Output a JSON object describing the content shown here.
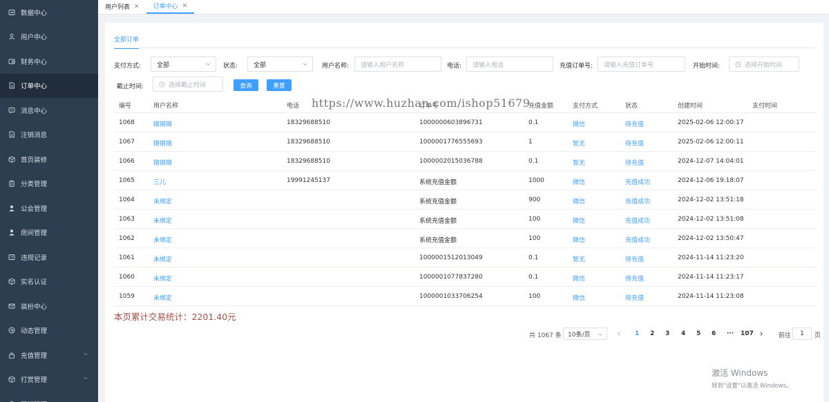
{
  "sidebar": {
    "items": [
      {
        "label": "数据中心",
        "icon": "dashboard-icon"
      },
      {
        "label": "用户中心",
        "icon": "user-icon"
      },
      {
        "label": "财务中心",
        "icon": "wallet-icon"
      },
      {
        "label": "订单中心",
        "icon": "document-icon",
        "active": true
      },
      {
        "label": "消息中心",
        "icon": "message-icon"
      },
      {
        "label": "注销消息",
        "icon": "document-icon"
      },
      {
        "label": "首页装修",
        "icon": "box-icon"
      },
      {
        "label": "分类管理",
        "icon": "clipboard-icon"
      },
      {
        "label": "公会管理",
        "icon": "person-icon"
      },
      {
        "label": "房间管理",
        "icon": "person-icon"
      },
      {
        "label": "违规记录",
        "icon": "list-icon"
      },
      {
        "label": "实名认证",
        "icon": "box-icon"
      },
      {
        "label": "装扮中心",
        "icon": "mail-icon"
      },
      {
        "label": "动态管理",
        "icon": "activity-icon"
      },
      {
        "label": "充值管理",
        "icon": "lock-icon",
        "caret": true
      },
      {
        "label": "打赏管理",
        "icon": "box-icon",
        "caret": true
      },
      {
        "label": "营销管理",
        "icon": "box-icon",
        "caret": true
      }
    ]
  },
  "tabs": [
    {
      "label": "用户列表",
      "close": "✕"
    },
    {
      "label": "订单中心",
      "close": "✕",
      "active": true
    }
  ],
  "subtab": {
    "label": "全部订单"
  },
  "filters": {
    "pay_method_label": "支付方式:",
    "pay_method_value": "全部",
    "status_label": "状态:",
    "status_value": "全部",
    "username_label": "用户名称:",
    "username_placeholder": "请输入用户名称",
    "phone_label": "电话:",
    "phone_placeholder": "请输入电话",
    "order_no_label": "充值订单号:",
    "order_no_placeholder": "请输入充值订单号",
    "start_label": "开始时间:",
    "start_placeholder": "选择开始时间",
    "end_label": "截止时间:",
    "end_placeholder": "选择截止时间",
    "query_button": "查询",
    "reset_button": "重置"
  },
  "table": {
    "headers": [
      "编号",
      "用户名称",
      "电话",
      "订单号",
      "充值金额",
      "支付方式",
      "状态",
      "创建时间",
      "支付时间"
    ],
    "rows": [
      {
        "id": "1068",
        "user": "锵锵锵",
        "phone": "18329688510",
        "order": "1000000603896731",
        "amount": "0.1",
        "method": "微信",
        "status": "待充值",
        "created": "2025-02-06 12:00:17",
        "paid": ""
      },
      {
        "id": "1067",
        "user": "锵锵锵",
        "phone": "18329688510",
        "order": "1000001776555693",
        "amount": "1",
        "method": "暂无",
        "status": "待充值",
        "created": "2025-02-06 12:00:11",
        "paid": ""
      },
      {
        "id": "1066",
        "user": "锵锵锵",
        "phone": "18329688510",
        "order": "1000002015036788",
        "amount": "0.1",
        "method": "暂无",
        "status": "待充值",
        "created": "2024-12-07 14:04:01",
        "paid": ""
      },
      {
        "id": "1065",
        "user": "三儿",
        "phone": "19991245137",
        "order": "系统充值金额",
        "amount": "1000",
        "method": "微信",
        "status": "充值成功",
        "created": "2024-12-06 19:18:07",
        "paid": ""
      },
      {
        "id": "1064",
        "user": "未绑定",
        "phone": "",
        "order": "系统充值金额",
        "amount": "900",
        "method": "微信",
        "status": "充值成功",
        "created": "2024-12-02 13:51:18",
        "paid": ""
      },
      {
        "id": "1063",
        "user": "未绑定",
        "phone": "",
        "order": "系统充值金额",
        "amount": "100",
        "method": "微信",
        "status": "充值成功",
        "created": "2024-12-02 13:51:08",
        "paid": ""
      },
      {
        "id": "1062",
        "user": "未绑定",
        "phone": "",
        "order": "系统充值金额",
        "amount": "100",
        "method": "微信",
        "status": "充值成功",
        "created": "2024-12-02 13:50:47",
        "paid": ""
      },
      {
        "id": "1061",
        "user": "未绑定",
        "phone": "",
        "order": "1000001512013049",
        "amount": "0.1",
        "method": "暂无",
        "status": "待充值",
        "created": "2024-11-14 11:23:20",
        "paid": ""
      },
      {
        "id": "1060",
        "user": "未绑定",
        "phone": "",
        "order": "1000001077837280",
        "amount": "0.1",
        "method": "微信",
        "status": "待充值",
        "created": "2024-11-14 11:23:17",
        "paid": ""
      },
      {
        "id": "1059",
        "user": "未绑定",
        "phone": "",
        "order": "1000001033706254",
        "amount": "100",
        "method": "微信",
        "status": "待充值",
        "created": "2024-11-14 11:23:08",
        "paid": ""
      }
    ]
  },
  "watermark": "https://www.huzhan.com/ishop51679",
  "summary": "本页累计交易统计：2201.40元",
  "pagination": {
    "total": "共 1067 条",
    "page_size": "10条/页",
    "pages": [
      "1",
      "2",
      "3",
      "4",
      "5",
      "6",
      "···",
      "107"
    ],
    "goto_label": "前往",
    "goto_value": "1",
    "goto_suffix": "页"
  },
  "windows_activation": {
    "title": "激活 Windows",
    "subtitle": "转到\"设置\"以激活 Windows。"
  },
  "colors": {
    "sidebar_bg": "#2c3e50",
    "accent": "#409eff",
    "summary": "#a0524a"
  }
}
